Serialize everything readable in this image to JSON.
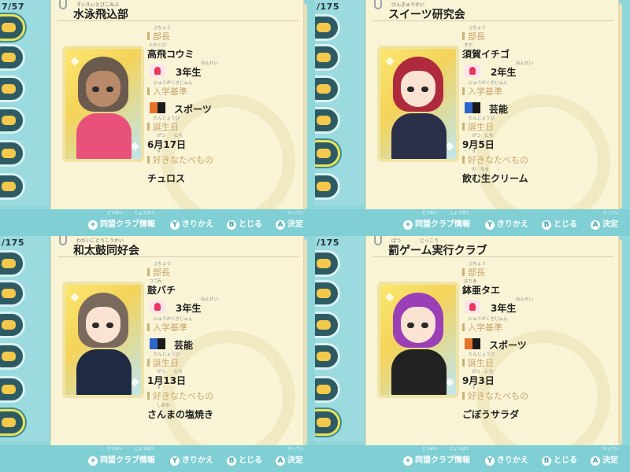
{
  "rail": {
    "total_a": "57",
    "total_b": "175"
  },
  "labels": {
    "leader": "部長",
    "leader_ruby": "ぶちょう",
    "entry": "入学基準",
    "entry_ruby": "にゅうがくきじゅん",
    "birthday": "誕生日",
    "birthday_ruby": "たんじょうび",
    "favorite": "好きなたべもの",
    "favorite_ruby": "す"
  },
  "footer": {
    "info": "同盟クラブ情報",
    "info_ruby": "どうめい　　　じょうほう",
    "info_btn": "+",
    "switch": "きりかえ",
    "switch_btn": "Y",
    "close": "とじる",
    "close_btn": "B",
    "confirm": "決定",
    "confirm_btn": "A",
    "confirm_ruby": "けってい"
  },
  "panels": [
    {
      "counter": "7/57",
      "club": "水泳飛込部",
      "club_ruby": "すいえいとびこみぶ",
      "leader_name": "高飛コウミ",
      "leader_ruby": "たかとび",
      "grade": "3年生",
      "grade_ruby": "ねんせい",
      "entry": "スポーツ",
      "birthday": "6月17日",
      "birthday_ruby": "がつ　　にち",
      "food": "チュロス",
      "food_ruby": "",
      "criterion_colors": [
        "#e8722c",
        "#1b1b1b"
      ],
      "hair_color": "#6b5a4e",
      "skin_color": "#b98a6a",
      "outfit_color": "#e8527a"
    },
    {
      "counter": "/175",
      "club": "スイーツ研究会",
      "club_ruby": "けんきゅうかい",
      "leader_name": "須賀イチゴ",
      "leader_ruby": "すが",
      "grade": "2年生",
      "grade_ruby": "ねんせい",
      "entry": "芸能",
      "birthday": "9月5日",
      "birthday_ruby": "がつ　にち",
      "food": "飲む生クリーム",
      "food_ruby": "の　なま",
      "criterion_colors": [
        "#2b67c9",
        "#1b1b1b"
      ],
      "hair_color": "#b02a3e",
      "skin_color": "#fbe3d3",
      "outfit_color": "#2a2f4a"
    },
    {
      "counter": "/175",
      "club": "和太鼓同好会",
      "club_ruby": "わだいこどうこうかい",
      "leader_name": "鼓バチ",
      "leader_ruby": "つづみ",
      "grade": "3年生",
      "grade_ruby": "ねんせい",
      "entry": "芸能",
      "birthday": "1月13日",
      "birthday_ruby": "がつ　　にち",
      "food": "さんまの塩焼き",
      "food_ruby": "しおや",
      "criterion_colors": [
        "#2b67c9",
        "#1b1b1b"
      ],
      "hair_color": "#7a6a5e",
      "skin_color": "#fbe3d3",
      "outfit_color": "#1f2a44"
    },
    {
      "counter": "/175",
      "club": "罰ゲーム実行クラブ",
      "club_ruby": "ばつ　　　　じっこう",
      "leader_name": "鉢亜タエ",
      "leader_ruby": "はちあ",
      "grade": "3年生",
      "grade_ruby": "ねんせい",
      "entry": "スポーツ",
      "birthday": "9月3日",
      "birthday_ruby": "がつ　にち",
      "food": "ごぼうサラダ",
      "food_ruby": "",
      "criterion_colors": [
        "#e8722c",
        "#1b1b1b"
      ],
      "hair_color": "#9a3fb5",
      "skin_color": "#fbe3d3",
      "outfit_color": "#222222"
    }
  ]
}
